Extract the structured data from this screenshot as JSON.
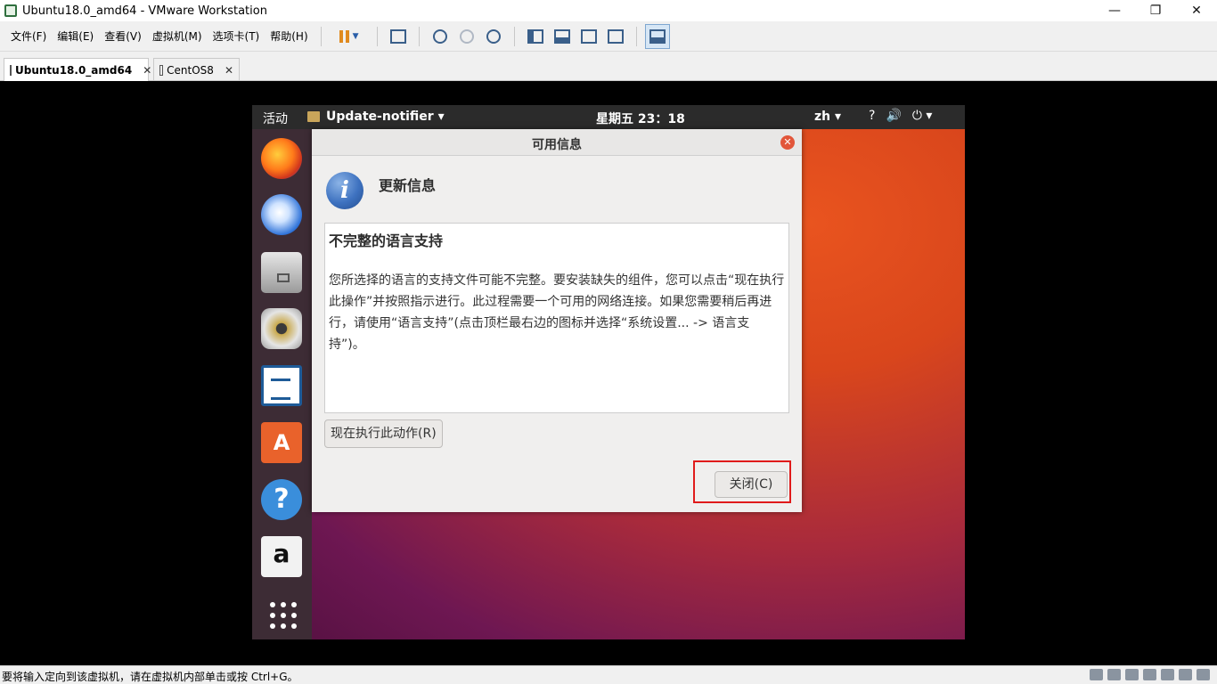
{
  "window": {
    "title": "Ubuntu18.0_amd64 - VMware Workstation",
    "minimize": "—",
    "restore": "❐",
    "close": "✕"
  },
  "menu": [
    "文件(F)",
    "编辑(E)",
    "查看(V)",
    "虚拟机(M)",
    "选项卡(T)",
    "帮助(H)"
  ],
  "tabs": {
    "active": "Ubuntu18.0_amd64",
    "second": "CentOS8",
    "close_glyph": "✕"
  },
  "ubuntu": {
    "activities": "活动",
    "app_menu": "Update-notifier ▾",
    "clock": "星期五 23：18",
    "lang": "zh ▾",
    "tray": [
      "?",
      "🔊",
      "⏻ ▾"
    ]
  },
  "dock": {
    "software": "A",
    "help": "?",
    "amazon": "a"
  },
  "dialog": {
    "title": "可用信息",
    "close_x": "✕",
    "info_glyph": "i",
    "heading": "更新信息",
    "message_title": "不完整的语言支持",
    "message_body": "您所选择的语言的支持文件可能不完整。要安装缺失的组件，您可以点击“现在执行此操作”并按照指示进行。此过程需要一个可用的网络连接。如果您需要稍后再进行，请使用“语言支持”(点击顶栏最右边的图标并选择“系统设置... -> 语言支持”)。",
    "action_button": "现在执行此动作(R)",
    "close_button": "关闭(C)"
  },
  "status": {
    "text": "要将输入定向到该虚拟机，请在虚拟机内部单击或按 Ctrl+G。"
  },
  "colors": {
    "highlight": "#e01b1b",
    "ubuntu_orange": "#e9541f",
    "ubuntu_purple": "#6e1752"
  }
}
